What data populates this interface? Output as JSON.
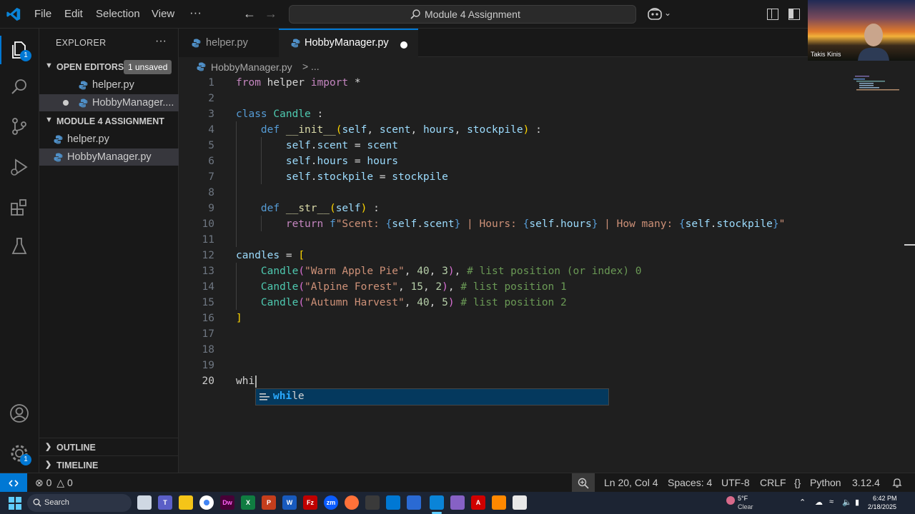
{
  "menu": [
    "File",
    "Edit",
    "Selection",
    "View",
    "···"
  ],
  "command_center": {
    "title": "Module 4 Assignment"
  },
  "webcam": {
    "name": "Takis Kinis"
  },
  "activity": {
    "explorer_badge": "1",
    "settings_badge": "1"
  },
  "sidebar": {
    "title": "EXPLORER",
    "more": "···",
    "open_editors": {
      "label": "OPEN EDITORS",
      "badge": "1 unsaved",
      "files": [
        "helper.py",
        "HobbyManager...."
      ]
    },
    "folder": {
      "label": "MODULE 4 ASSIGNMENT",
      "files": [
        "helper.py",
        "HobbyManager.py"
      ]
    },
    "outline": "OUTLINE",
    "timeline": "TIMELINE"
  },
  "tabs": [
    {
      "label": "helper.py"
    },
    {
      "label": "HobbyManager.py"
    }
  ],
  "breadcrumb": {
    "file": "HobbyManager.py",
    "sep": ">",
    "more": "..."
  },
  "editor": {
    "line_numbers": [
      "1",
      "2",
      "3",
      "4",
      "5",
      "6",
      "7",
      "8",
      "9",
      "10",
      "11",
      "12",
      "13",
      "14",
      "15",
      "16",
      "17",
      "18",
      "19",
      "20"
    ],
    "typed": "whi",
    "suggestion": {
      "match": "whi",
      "rest": "le"
    }
  },
  "status": {
    "problems_errors": "0",
    "problems_warnings": "0",
    "position": "Ln 20, Col 4",
    "spaces": "Spaces: 4",
    "encoding": "UTF-8",
    "eol": "CRLF",
    "language": "Python",
    "interpreter": "3.12.4"
  },
  "taskbar": {
    "search": "Search",
    "weather_temp": "5°F",
    "weather_desc": "Clear",
    "time": "6:42 PM",
    "date": "2/18/2025"
  },
  "colors": {
    "accent": "#0078d4",
    "keyword": "#569cd6",
    "class": "#4ec9b0",
    "string": "#ce9178",
    "comment": "#6a9955"
  }
}
